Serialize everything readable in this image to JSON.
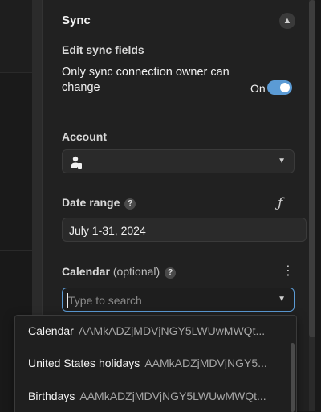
{
  "section": {
    "title": "Sync"
  },
  "edit_sync": {
    "title": "Edit sync fields",
    "owner_text": "Only sync connection owner can change",
    "toggle_label": "On",
    "toggle_state": true
  },
  "account": {
    "label": "Account",
    "icon": "person-phone-icon"
  },
  "date_range": {
    "label": "Date range",
    "value": "July 1-31, 2024"
  },
  "calendar": {
    "label": "Calendar",
    "optional": "(optional)",
    "placeholder": "Type to search",
    "options": [
      {
        "name": "Calendar",
        "id": "AAMkADZjMDVjNGY5LWUwMWQt..."
      },
      {
        "name": "United States holidays",
        "id": "AAMkADZjMDVjNGY5..."
      },
      {
        "name": "Birthdays",
        "id": "AAMkADZjMDVjNGY5LWUwMWQt..."
      }
    ]
  },
  "colors": {
    "accent": "#5b9bd5",
    "panel": "#212121"
  }
}
